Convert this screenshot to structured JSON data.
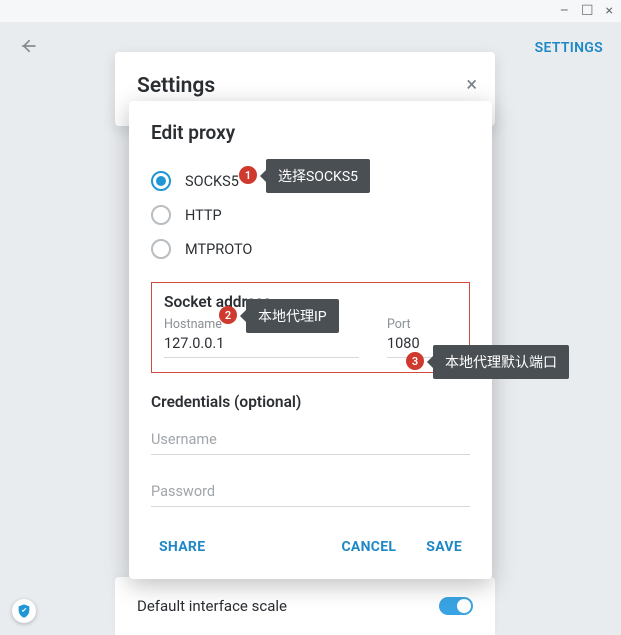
{
  "window": {
    "settings_link": "SETTINGS"
  },
  "settings_card": {
    "title": "Settings"
  },
  "bottom": {
    "label": "Default interface scale"
  },
  "dialog": {
    "title": "Edit proxy",
    "radios": {
      "socks5": "SOCKS5",
      "http": "HTTP",
      "mtproto": "MTPROTO"
    },
    "socket_section": "Socket address",
    "hostname_label": "Hostname",
    "hostname_value": "127.0.0.1",
    "port_label": "Port",
    "port_value": "1080",
    "credentials_section": "Credentials (optional)",
    "username_placeholder": "Username",
    "password_placeholder": "Password",
    "actions": {
      "share": "SHARE",
      "cancel": "CANCEL",
      "save": "SAVE"
    }
  },
  "annotations": {
    "n1": "1",
    "n2": "2",
    "n3": "3",
    "t1": "选择SOCKS5",
    "t2": "本地代理IP",
    "t3": "本地代理默认端口"
  }
}
